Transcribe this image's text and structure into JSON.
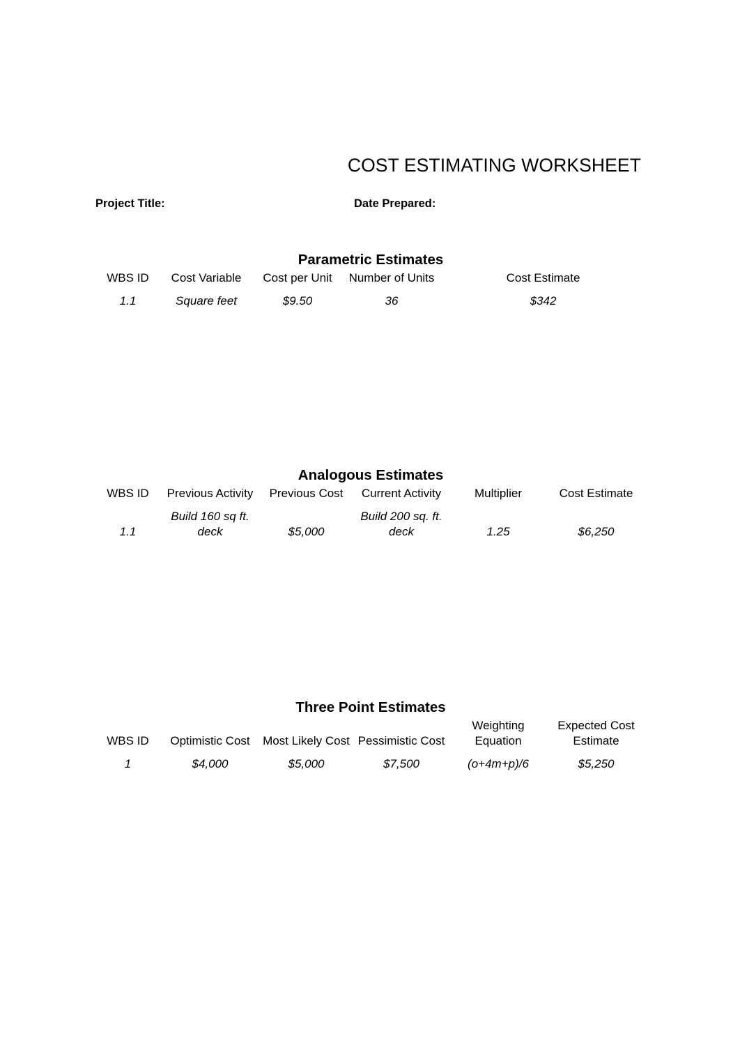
{
  "document": {
    "title": "COST ESTIMATING WORKSHEET",
    "project_title_label": "Project Title:",
    "project_title_value": "",
    "date_prepared_label": "Date Prepared:",
    "date_prepared_value": ""
  },
  "sections": {
    "parametric": {
      "heading": "Parametric Estimates",
      "columns": [
        "WBS ID",
        "Cost Variable",
        "Cost per Unit",
        "Number of Units",
        "Cost Estimate"
      ],
      "rows": [
        {
          "wbs_id": "1.1",
          "cost_variable": "Square feet",
          "cost_per_unit": "$9.50",
          "number_of_units": "36",
          "cost_estimate": "$342"
        }
      ]
    },
    "analogous": {
      "heading": "Analogous Estimates",
      "columns": [
        "WBS ID",
        "Previous Activity",
        "Previous Cost",
        "Current Activity",
        "Multiplier",
        "Cost Estimate"
      ],
      "rows": [
        {
          "wbs_id": "1.1",
          "previous_activity": "Build 160 sq ft. deck",
          "previous_cost": "$5,000",
          "current_activity": "Build 200 sq. ft. deck",
          "multiplier": "1.25",
          "cost_estimate": "$6,250"
        }
      ]
    },
    "three_point": {
      "heading": "Three Point Estimates",
      "columns": [
        "WBS ID",
        "Optimistic Cost",
        "Most Likely Cost",
        "Pessimistic Cost",
        "Weighting Equation",
        "Expected Cost Estimate"
      ],
      "rows": [
        {
          "wbs_id": "1",
          "optimistic_cost": "$4,000",
          "most_likely_cost": "$5,000",
          "pessimistic_cost": "$7,500",
          "weighting_equation": "(o+4m+p)/6",
          "expected_cost_estimate": "$5,250"
        }
      ]
    }
  }
}
